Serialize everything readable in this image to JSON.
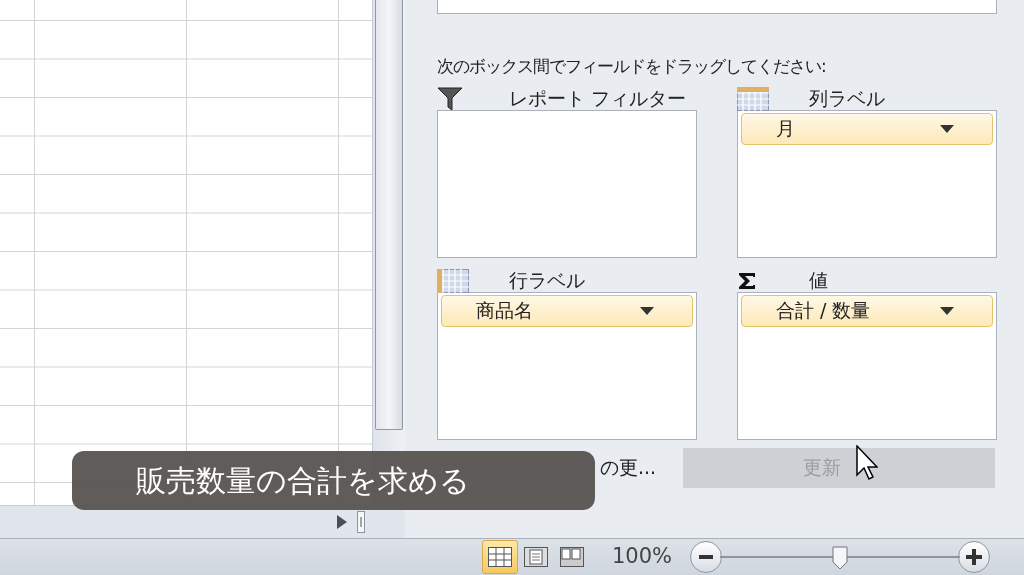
{
  "panel": {
    "instruction": "次のボックス間でフィールドをドラッグしてください:",
    "areas": [
      {
        "kind": "filter",
        "label": "レポート フィルター"
      },
      {
        "kind": "columns",
        "label": "列ラベル",
        "fields": [
          {
            "label": "月"
          }
        ]
      },
      {
        "kind": "rows",
        "label": "行ラベル",
        "fields": [
          {
            "label": "商品名"
          }
        ]
      },
      {
        "kind": "values",
        "label": "値",
        "fields": [
          {
            "label": "合計 / 数量"
          }
        ]
      }
    ],
    "defer_update": {
      "label": "の更..."
    },
    "update_button": {
      "label": "更新",
      "disabled": true
    }
  },
  "status_bar": {
    "views": [
      {
        "kind": "normal",
        "selected": true
      },
      {
        "kind": "page-layout",
        "selected": false
      },
      {
        "kind": "page-break",
        "selected": false
      }
    ],
    "zoom": "100%",
    "zoom_slider": {
      "level": 0.5
    }
  },
  "caption": "販売数量の合計を求める"
}
